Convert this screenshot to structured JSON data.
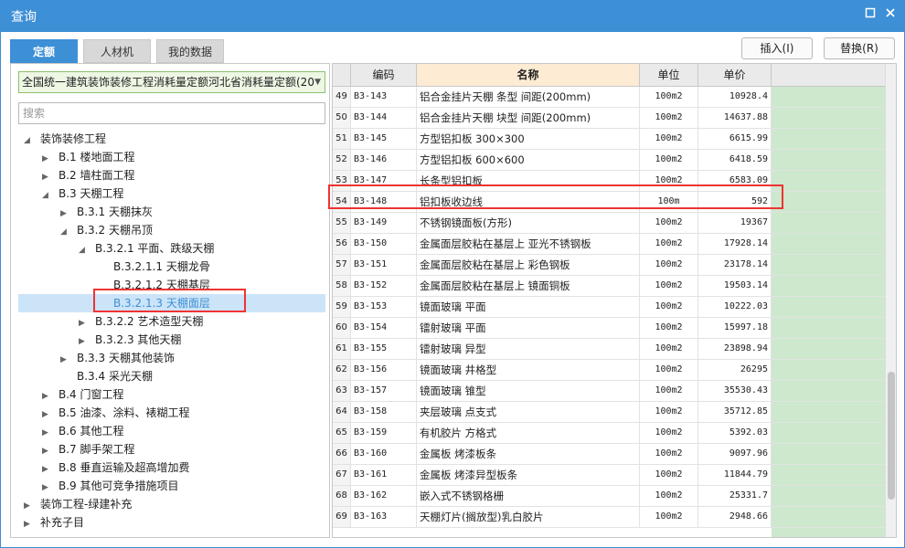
{
  "window": {
    "title": "查询",
    "restore_icon": "restore-icon",
    "close_icon": "close-icon"
  },
  "tabs": [
    "定额",
    "人材机",
    "我的数据"
  ],
  "buttons": {
    "insert": "插入(I)",
    "replace": "替换(R)"
  },
  "left": {
    "combo_value": "全国统一建筑装饰装修工程消耗量定额河北省消耗量定额(20",
    "search_placeholder": "搜索",
    "tree": [
      {
        "label": "装饰装修工程",
        "depth": 0,
        "toggle": "open"
      },
      {
        "label": "B.1 楼地面工程",
        "depth": 1,
        "toggle": "closed"
      },
      {
        "label": "B.2 墙柱面工程",
        "depth": 1,
        "toggle": "closed"
      },
      {
        "label": "B.3 天棚工程",
        "depth": 1,
        "toggle": "open"
      },
      {
        "label": "B.3.1 天棚抹灰",
        "depth": 2,
        "toggle": "closed"
      },
      {
        "label": "B.3.2 天棚吊顶",
        "depth": 2,
        "toggle": "open"
      },
      {
        "label": "B.3.2.1 平面、跌级天棚",
        "depth": 3,
        "toggle": "open"
      },
      {
        "label": "B.3.2.1.1 天棚龙骨",
        "depth": 4,
        "toggle": "none"
      },
      {
        "label": "B.3.2.1.2 天棚基层",
        "depth": 4,
        "toggle": "none"
      },
      {
        "label": "B.3.2.1.3 天棚面层",
        "depth": 4,
        "toggle": "none",
        "selected": true
      },
      {
        "label": "B.3.2.2 艺术造型天棚",
        "depth": 3,
        "toggle": "closed"
      },
      {
        "label": "B.3.2.3 其他天棚",
        "depth": 3,
        "toggle": "closed"
      },
      {
        "label": "B.3.3 天棚其他装饰",
        "depth": 2,
        "toggle": "closed"
      },
      {
        "label": "B.3.4 采光天棚",
        "depth": 2,
        "toggle": "none"
      },
      {
        "label": "B.4 门窗工程",
        "depth": 1,
        "toggle": "closed"
      },
      {
        "label": "B.5 油漆、涂料、裱糊工程",
        "depth": 1,
        "toggle": "closed"
      },
      {
        "label": "B.6 其他工程",
        "depth": 1,
        "toggle": "closed"
      },
      {
        "label": "B.7 脚手架工程",
        "depth": 1,
        "toggle": "closed"
      },
      {
        "label": "B.8 垂直运输及超高增加费",
        "depth": 1,
        "toggle": "closed"
      },
      {
        "label": "B.9 其他可竞争措施项目",
        "depth": 1,
        "toggle": "closed"
      },
      {
        "label": "装饰工程-绿建补充",
        "depth": 0,
        "toggle": "closed"
      },
      {
        "label": "补充子目",
        "depth": 0,
        "toggle": "closed"
      }
    ]
  },
  "grid": {
    "headers": {
      "code": "编码",
      "name": "名称",
      "unit": "单位",
      "price": "单价"
    },
    "rows": [
      {
        "no": "49",
        "code": "B3-143",
        "name": "铝合金挂片天棚 条型 间距(200mm)",
        "unit": "100m2",
        "price": "10928.4"
      },
      {
        "no": "50",
        "code": "B3-144",
        "name": "铝合金挂片天棚 块型 间距(200mm)",
        "unit": "100m2",
        "price": "14637.88"
      },
      {
        "no": "51",
        "code": "B3-145",
        "name": "方型铝扣板 300×300",
        "unit": "100m2",
        "price": "6615.99"
      },
      {
        "no": "52",
        "code": "B3-146",
        "name": "方型铝扣板 600×600",
        "unit": "100m2",
        "price": "6418.59"
      },
      {
        "no": "53",
        "code": "B3-147",
        "name": "长条型铝扣板",
        "unit": "100m2",
        "price": "6583.09"
      },
      {
        "no": "54",
        "code": "B3-148",
        "name": "铝扣板收边线",
        "unit": "100m",
        "price": "592"
      },
      {
        "no": "55",
        "code": "B3-149",
        "name": "不锈钢镜面板(方形)",
        "unit": "100m2",
        "price": "19367"
      },
      {
        "no": "56",
        "code": "B3-150",
        "name": "金属面层胶粘在基层上 亚光不锈钢板",
        "unit": "100m2",
        "price": "17928.14"
      },
      {
        "no": "57",
        "code": "B3-151",
        "name": "金属面层胶粘在基层上 彩色钢板",
        "unit": "100m2",
        "price": "23178.14"
      },
      {
        "no": "58",
        "code": "B3-152",
        "name": "金属面层胶粘在基层上 镜面铜板",
        "unit": "100m2",
        "price": "19503.14"
      },
      {
        "no": "59",
        "code": "B3-153",
        "name": "镜面玻璃 平面",
        "unit": "100m2",
        "price": "10222.03"
      },
      {
        "no": "60",
        "code": "B3-154",
        "name": "镭射玻璃 平面",
        "unit": "100m2",
        "price": "15997.18"
      },
      {
        "no": "61",
        "code": "B3-155",
        "name": "镭射玻璃 异型",
        "unit": "100m2",
        "price": "23898.94"
      },
      {
        "no": "62",
        "code": "B3-156",
        "name": "镜面玻璃 井格型",
        "unit": "100m2",
        "price": "26295"
      },
      {
        "no": "63",
        "code": "B3-157",
        "name": "镜面玻璃 锥型",
        "unit": "100m2",
        "price": "35530.43"
      },
      {
        "no": "64",
        "code": "B3-158",
        "name": "夹层玻璃 点支式",
        "unit": "100m2",
        "price": "35712.85"
      },
      {
        "no": "65",
        "code": "B3-159",
        "name": "有机胶片 方格式",
        "unit": "100m2",
        "price": "5392.03"
      },
      {
        "no": "66",
        "code": "B3-160",
        "name": "金属板 烤漆板条",
        "unit": "100m2",
        "price": "9097.96"
      },
      {
        "no": "67",
        "code": "B3-161",
        "name": "金属板 烤漆异型板条",
        "unit": "100m2",
        "price": "11844.79"
      },
      {
        "no": "68",
        "code": "B3-162",
        "name": "嵌入式不锈钢格栅",
        "unit": "100m2",
        "price": "25331.7"
      },
      {
        "no": "69",
        "code": "B3-163",
        "name": "天棚灯片(搁放型)乳白胶片",
        "unit": "100m2",
        "price": "2948.66"
      }
    ]
  }
}
